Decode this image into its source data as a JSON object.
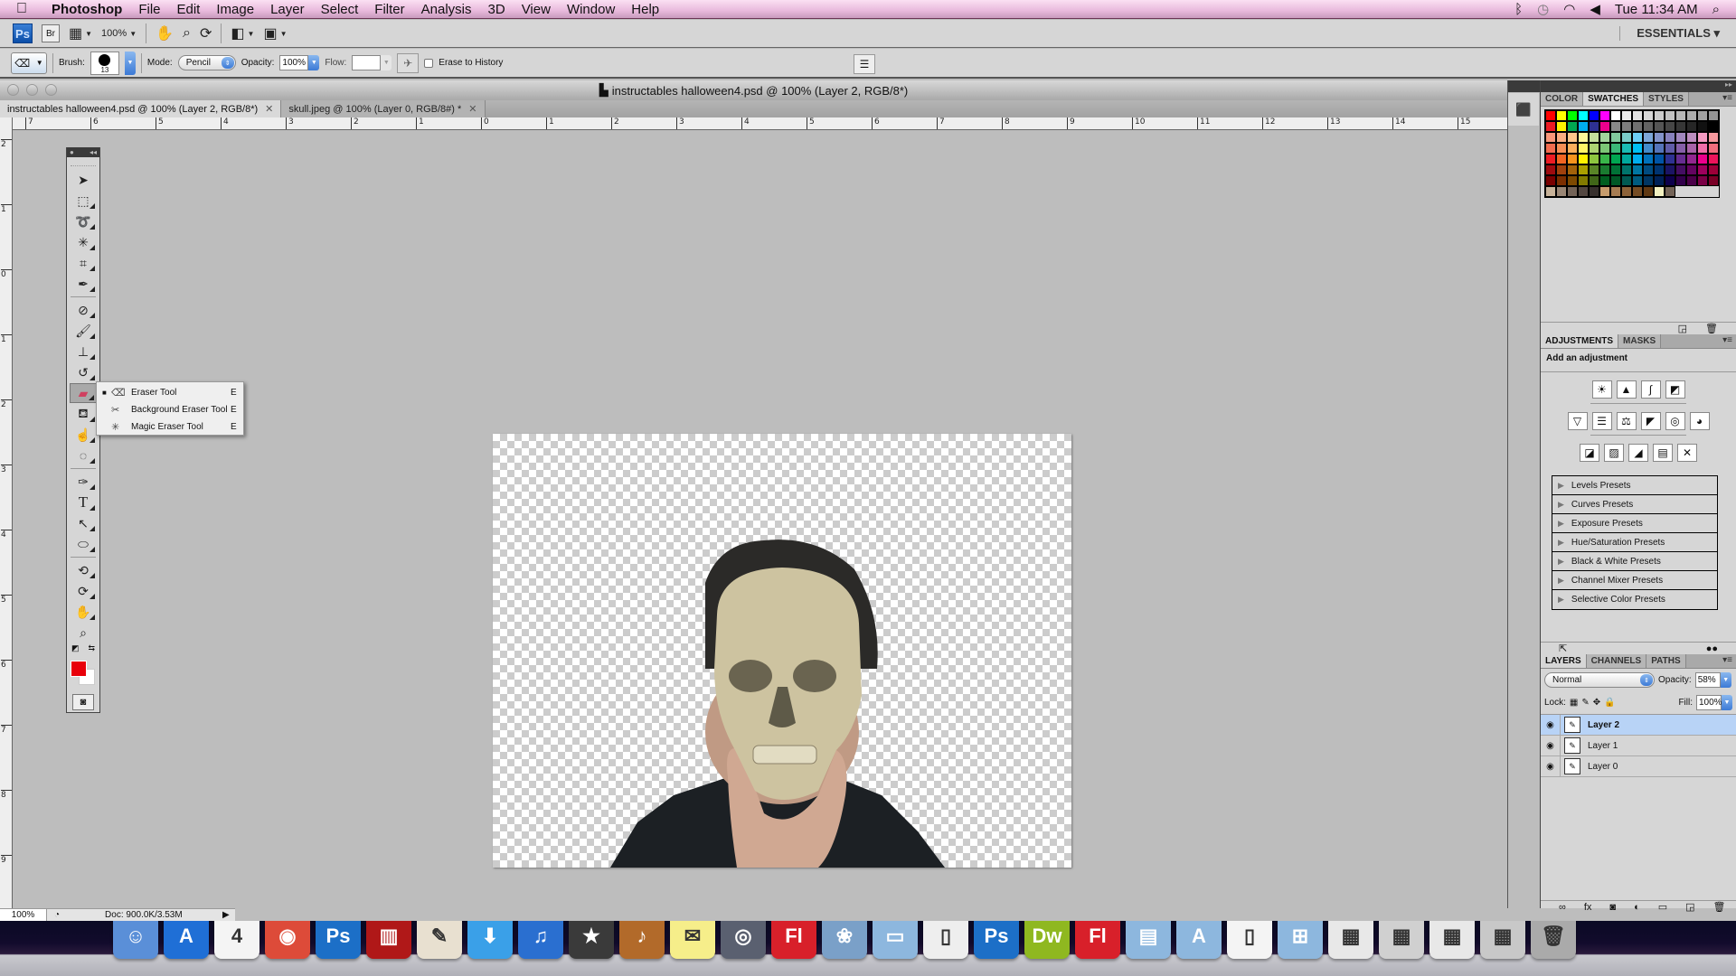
{
  "menubar": {
    "app_name": "Photoshop",
    "items": [
      "File",
      "Edit",
      "Image",
      "Layer",
      "Select",
      "Filter",
      "Analysis",
      "3D",
      "View",
      "Window",
      "Help"
    ],
    "clock": "Tue 11:34 AM",
    "status_icons": [
      "bluetooth-icon",
      "time-machine-icon",
      "wifi-icon",
      "volume-icon",
      "spotlight-icon"
    ]
  },
  "appbar": {
    "ps_badge": "Ps",
    "br_badge": "Br",
    "zoom_level": "100%",
    "workspace": "ESSENTIALS ▾"
  },
  "options": {
    "brush_label": "Brush:",
    "brush_size": "13",
    "mode_label": "Mode:",
    "mode_value": "Pencil",
    "opacity_label": "Opacity:",
    "opacity_value": "100%",
    "flow_label": "Flow:",
    "flow_value": "",
    "erase_history_label": "Erase to History"
  },
  "window": {
    "title": "instructables halloween4.psd @ 100% (Layer 2, RGB/8*)"
  },
  "tabs": [
    {
      "label": "instructables halloween4.psd @ 100% (Layer 2, RGB/8*)",
      "active": true
    },
    {
      "label": "skull.jpeg @ 100% (Layer 0, RGB/8#) *",
      "active": false
    }
  ],
  "ruler": {
    "top_labels": [
      "7",
      "6",
      "5",
      "4",
      "3",
      "2",
      "1",
      "0",
      "1",
      "2",
      "3",
      "4",
      "5",
      "6",
      "7",
      "8",
      "9",
      "10",
      "11",
      "12",
      "13",
      "14",
      "15"
    ],
    "left_labels": [
      "2",
      "1",
      "0",
      "1",
      "2",
      "3",
      "4",
      "5",
      "6",
      "7",
      "8",
      "9"
    ]
  },
  "toolbox": {
    "tools": [
      "move",
      "marquee",
      "lasso",
      "magic-wand",
      "crop",
      "eyedropper",
      "healing",
      "brush",
      "clone-stamp",
      "history-brush",
      "eraser",
      "paint-bucket",
      "dodge",
      "burn",
      "pen",
      "type",
      "path-select",
      "shape",
      "3d-rotate",
      "3d-orbit",
      "hand",
      "zoom"
    ],
    "active_tool": "eraser",
    "foreground_color": "#e8000a",
    "background_color": "#ffffff"
  },
  "flyout": {
    "items": [
      {
        "label": "Eraser Tool",
        "shortcut": "E",
        "selected": true
      },
      {
        "label": "Background Eraser Tool",
        "shortcut": "E",
        "selected": false
      },
      {
        "label": "Magic Eraser Tool",
        "shortcut": "E",
        "selected": false
      }
    ]
  },
  "status": {
    "zoom": "100%",
    "doc_size": "Doc: 900.0K/3.53M"
  },
  "swatch_panel": {
    "tabs": [
      "COLOR",
      "SWATCHES",
      "STYLES"
    ],
    "active_tab": "SWATCHES",
    "colors": [
      "#ff0000",
      "#ffff00",
      "#00ff00",
      "#00ffff",
      "#0000ff",
      "#ff00ff",
      "#ffffff",
      "#ebebeb",
      "#e1e1e1",
      "#d7d7d7",
      "#cccccc",
      "#c2c2c2",
      "#b7b7b7",
      "#acacac",
      "#a0a0a0",
      "#959595",
      "#ed1c24",
      "#fff200",
      "#00a651",
      "#00aeef",
      "#2e3192",
      "#ec008c",
      "#898989",
      "#7d7d7d",
      "#707070",
      "#626262",
      "#555555",
      "#464646",
      "#363636",
      "#262626",
      "#111111",
      "#000000",
      "#f7977a",
      "#f9ad81",
      "#fdc68a",
      "#fff79a",
      "#c4df9b",
      "#a3d39c",
      "#82ca9d",
      "#7accc8",
      "#6dcff6",
      "#7da7d9",
      "#8393ca",
      "#8781bd",
      "#a187be",
      "#bc8dbf",
      "#f49ac2",
      "#f6989d",
      "#f26c4f",
      "#f68e55",
      "#fbaf5c",
      "#fff467",
      "#acd372",
      "#7cc576",
      "#3bb878",
      "#1abbb4",
      "#00bff3",
      "#438ccb",
      "#5574b9",
      "#605ca8",
      "#855fa8",
      "#a763a8",
      "#f06ea9",
      "#f26d7d",
      "#ed1c24",
      "#f26522",
      "#f7941d",
      "#fff200",
      "#8dc63f",
      "#39b54a",
      "#00a651",
      "#00a99d",
      "#00aeef",
      "#0072bc",
      "#0054a6",
      "#2e3192",
      "#662d91",
      "#92278f",
      "#ec008c",
      "#ed145b",
      "#9e0b0f",
      "#a0410d",
      "#a3620a",
      "#aba000",
      "#598527",
      "#1a7b30",
      "#007236",
      "#00746b",
      "#0076a3",
      "#004b80",
      "#003471",
      "#1b1464",
      "#440e62",
      "#630460",
      "#9e005d",
      "#9e0039",
      "#790000",
      "#7b2e00",
      "#7d4900",
      "#827b00",
      "#406618",
      "#005e20",
      "#005826",
      "#005952",
      "#005b7f",
      "#003663",
      "#002157",
      "#0d004c",
      "#32004b",
      "#4b0049",
      "#7b0046",
      "#7a0026",
      "#c7b299",
      "#998675",
      "#736357",
      "#534741",
      "#37302d",
      "#c69c6d",
      "#a67c52",
      "#8c6239",
      "#754c24",
      "#603913",
      "#f2f0c0",
      "#736357"
    ]
  },
  "adjustments": {
    "tabs": [
      "ADJUSTMENTS",
      "MASKS"
    ],
    "active_tab": "ADJUSTMENTS",
    "title": "Add an adjustment",
    "presets": [
      "Levels Presets",
      "Curves Presets",
      "Exposure Presets",
      "Hue/Saturation Presets",
      "Black & White Presets",
      "Channel Mixer Presets",
      "Selective Color Presets"
    ]
  },
  "layers": {
    "tabs": [
      "LAYERS",
      "CHANNELS",
      "PATHS"
    ],
    "active_tab": "LAYERS",
    "blend_mode": "Normal",
    "opacity_label": "Opacity:",
    "opacity": "58%",
    "lock_label": "Lock:",
    "fill_label": "Fill:",
    "fill": "100%",
    "items": [
      {
        "name": "Layer 2",
        "visible": true,
        "selected": true
      },
      {
        "name": "Layer 1",
        "visible": true,
        "selected": false
      },
      {
        "name": "Layer 0",
        "visible": true,
        "selected": false
      }
    ]
  },
  "dock": {
    "apps": [
      {
        "name": "Finder",
        "glyph": "☺",
        "color": "#5a8fd8"
      },
      {
        "name": "App Store",
        "glyph": "A",
        "color": "#1f6fd6"
      },
      {
        "name": "iCal",
        "glyph": "4",
        "color": "#f4f4f4"
      },
      {
        "name": "Chrome",
        "glyph": "◉",
        "color": "#dd4b39"
      },
      {
        "name": "Photoshop",
        "glyph": "Ps",
        "color": "#1c6fc7"
      },
      {
        "name": "Photo Booth",
        "glyph": "▥",
        "color": "#b01818"
      },
      {
        "name": "SketchUp",
        "glyph": "✎",
        "color": "#e8e0d0"
      },
      {
        "name": "Downloads",
        "glyph": "⬇",
        "color": "#3aa0e8"
      },
      {
        "name": "iTunes",
        "glyph": "♫",
        "color": "#2a6fd0"
      },
      {
        "name": "iMovie",
        "glyph": "★",
        "color": "#3a3a3a"
      },
      {
        "name": "GarageBand",
        "glyph": "♪",
        "color": "#b26a2a"
      },
      {
        "name": "Stickies",
        "glyph": "✉",
        "color": "#f6ee8a"
      },
      {
        "name": "Image Capture",
        "glyph": "◎",
        "color": "#5a6070"
      },
      {
        "name": "Flash",
        "glyph": "Fl",
        "color": "#d8202a"
      },
      {
        "name": "iPhoto",
        "glyph": "❀",
        "color": "#7aa0c8"
      },
      {
        "name": "Folder",
        "glyph": "▭",
        "color": "#8db7de"
      },
      {
        "name": "Disk Image",
        "glyph": "▯",
        "color": "#eeeeee"
      },
      {
        "name": "Photoshop CS",
        "glyph": "Ps",
        "color": "#1c6fc7"
      },
      {
        "name": "Dreamweaver",
        "glyph": "Dw",
        "color": "#8fb820"
      },
      {
        "name": "Flash CS",
        "glyph": "Fl",
        "color": "#d8202a"
      },
      {
        "name": "Documents",
        "glyph": "▤",
        "color": "#8db7de"
      },
      {
        "name": "Applications",
        "glyph": "A",
        "color": "#8db7de"
      },
      {
        "name": "File",
        "glyph": "▯",
        "color": "#f4f4f4"
      },
      {
        "name": "Windows",
        "glyph": "⊞",
        "color": "#8db7de"
      },
      {
        "name": "Chrome Window",
        "glyph": "▦",
        "color": "#e8e8e8"
      },
      {
        "name": "Flash Window",
        "glyph": "▦",
        "color": "#d0d0d0"
      },
      {
        "name": "Finder Window",
        "glyph": "▦",
        "color": "#e8e8e8"
      },
      {
        "name": "Preview Window",
        "glyph": "▦",
        "color": "#c8c8c8"
      },
      {
        "name": "Trash",
        "glyph": "🗑",
        "color": "#aaaaaa"
      }
    ]
  }
}
